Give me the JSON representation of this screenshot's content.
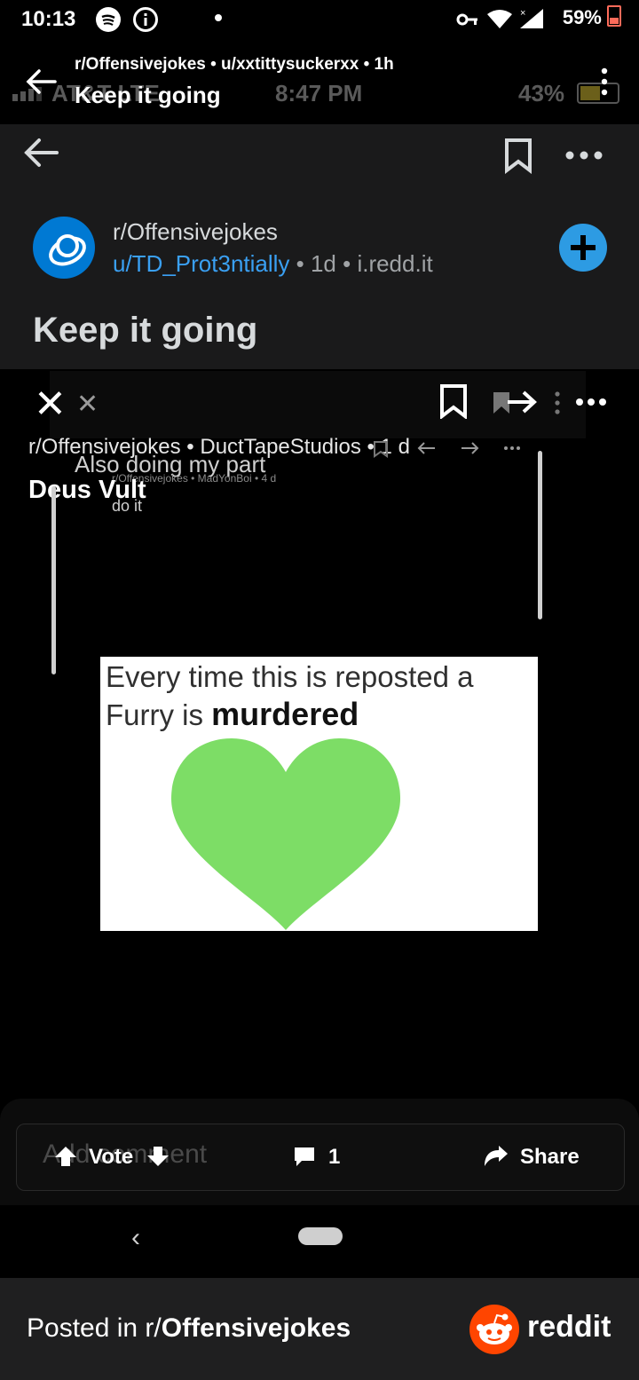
{
  "status_bar": {
    "time": "10:13",
    "battery": "59%"
  },
  "outer_header": {
    "subtitle": "r/Offensivejokes • u/xxtittysuckerxx • 1h",
    "title": "Keep it going",
    "ghost_carrier": "AT&T LTE",
    "ghost_time": "8:47 PM",
    "ghost_battery": "43%"
  },
  "post_card": {
    "subreddit": "r/Offensivejokes",
    "user": "u/TD_Prot3ntially",
    "meta": " • 1d • i.redd.it",
    "title": "Keep it going"
  },
  "nested_1": {
    "meta": "r/Offensivejokes • DuctTapeStudios • 1 d",
    "title": "Deus Vult"
  },
  "nested_2": {
    "title": "Also doing my part",
    "meta": "r/Offensivejokes • MadYonBoi • 4 d",
    "subtitle": "do it"
  },
  "meme": {
    "line1": "Every time this is reposted a",
    "line2_prefix": "Furry is ",
    "line2_bold": "murdered",
    "heart_color": "#7ddd66"
  },
  "action_bar": {
    "ghost_placeholder": "Add comment",
    "vote_label": "Vote",
    "comment_count": "1",
    "share_label": "Share"
  },
  "footer": {
    "prefix": "Posted in r/",
    "subreddit": "Offensivejokes",
    "brand": "reddit"
  },
  "colors": {
    "accent_blue": "#0079d3",
    "user_link": "#3aa0f3",
    "reddit_orange": "#ff4500"
  }
}
